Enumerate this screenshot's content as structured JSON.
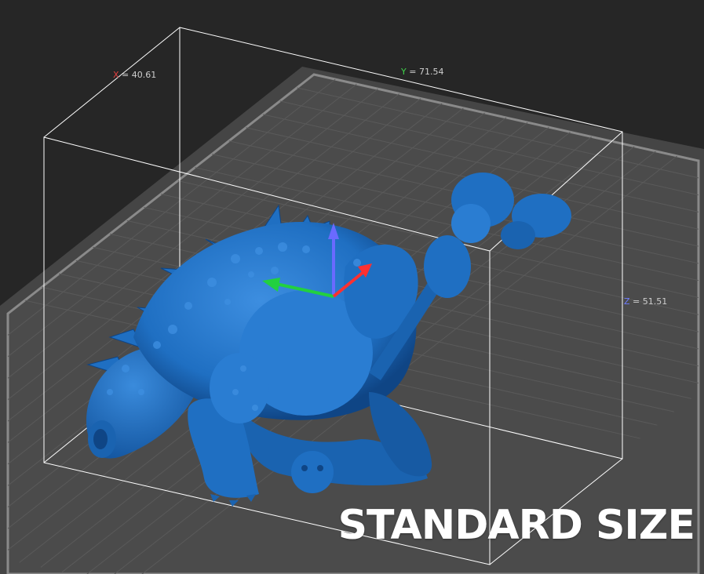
{
  "viewport": {
    "background_color": "#262626",
    "plate_color": "#4b4b4b",
    "plate_border_color": "#8a8a8a",
    "grid_color": "#5a5a5a",
    "bounding_box_color": "#ffffff",
    "model_color": "#1f6fc2",
    "model_highlight_color": "#3d8ee0",
    "model_shadow_color": "#0f4585"
  },
  "dimensions": {
    "x": {
      "axis": "X",
      "separator": " = ",
      "value": "40.61",
      "color": "#e04040"
    },
    "y": {
      "axis": "Y",
      "separator": " = ",
      "value": "71.54",
      "color": "#3fd34a"
    },
    "z": {
      "axis": "Z",
      "separator": " = ",
      "value": "51.51",
      "color": "#6f7cff"
    }
  },
  "gizmo": {
    "x_color": "#ff3030",
    "y_color": "#22d040",
    "z_color": "#6a6aff"
  },
  "caption": "STANDARD SIZE"
}
